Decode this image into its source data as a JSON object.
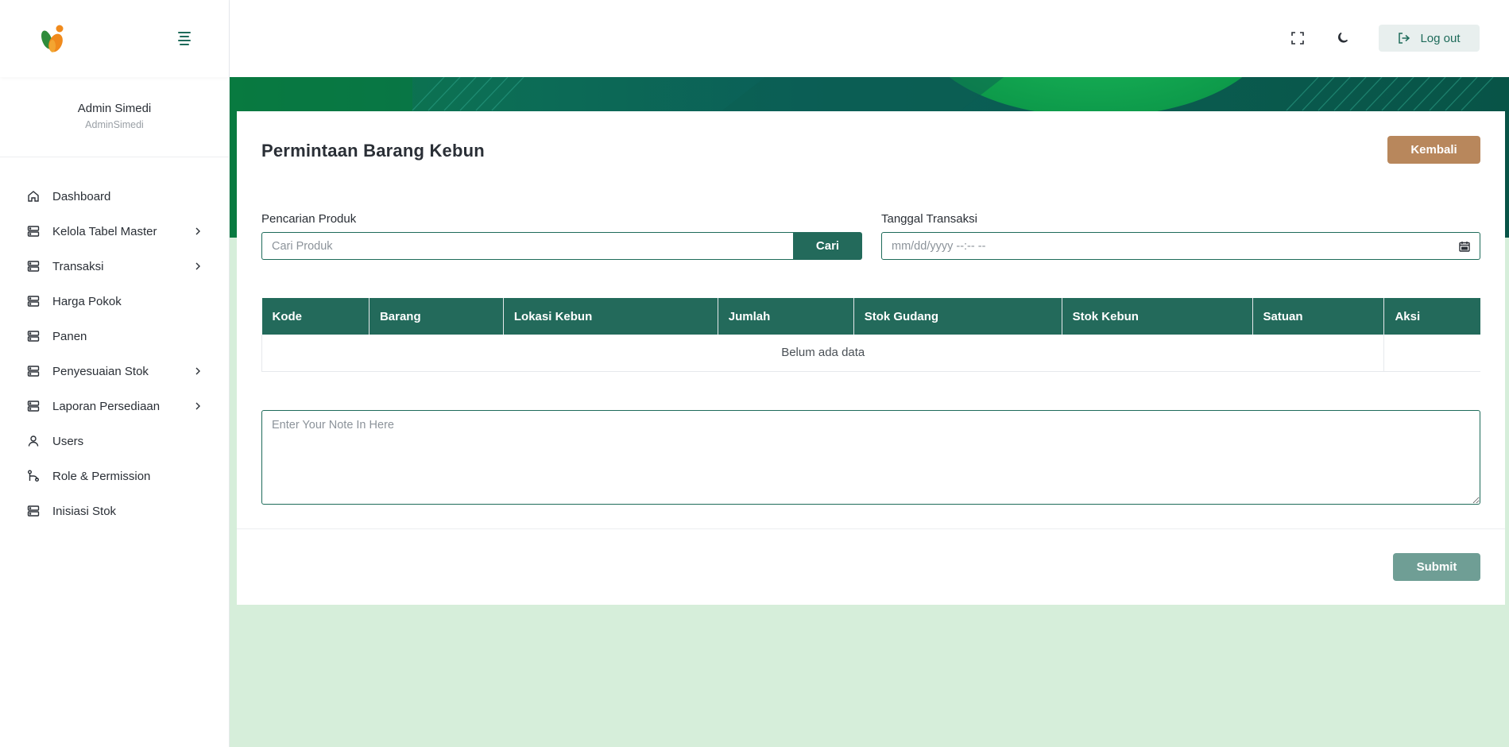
{
  "brand": {
    "logo_icon": "leaf-person-logo",
    "accent": "#236a5b",
    "accent_light": "#d6eeda"
  },
  "user": {
    "name": "Admin Simedi",
    "handle": "AdminSimedi"
  },
  "sidebar": {
    "items": [
      {
        "label": "Dashboard",
        "icon": "home-icon",
        "has_submenu": false
      },
      {
        "label": "Kelola Tabel Master",
        "icon": "server-icon",
        "has_submenu": true
      },
      {
        "label": "Transaksi",
        "icon": "server-icon",
        "has_submenu": true
      },
      {
        "label": "Harga Pokok",
        "icon": "server-icon",
        "has_submenu": false
      },
      {
        "label": "Panen",
        "icon": "server-icon",
        "has_submenu": false
      },
      {
        "label": "Penyesuaian Stok",
        "icon": "server-icon",
        "has_submenu": true
      },
      {
        "label": "Laporan Persediaan",
        "icon": "server-icon",
        "has_submenu": true
      },
      {
        "label": "Users",
        "icon": "user-icon",
        "has_submenu": false
      },
      {
        "label": "Role & Permission",
        "icon": "git-branch-icon",
        "has_submenu": false
      },
      {
        "label": "Inisiasi Stok",
        "icon": "server-icon",
        "has_submenu": false
      }
    ]
  },
  "header": {
    "logout_label": "Log out"
  },
  "page": {
    "title": "Permintaan Barang Kebun",
    "back_label": "Kembali",
    "search": {
      "label": "Pencarian Produk",
      "placeholder": "Cari Produk",
      "value": "",
      "button_label": "Cari"
    },
    "date": {
      "label": "Tanggal Transaksi",
      "placeholder": "mm/dd/yyyy --:-- --"
    },
    "table": {
      "columns": [
        "Kode",
        "Barang",
        "Lokasi Kebun",
        "Jumlah",
        "Stok Gudang",
        "Stok Kebun",
        "Satuan",
        "Aksi"
      ],
      "empty_text": "Belum ada data"
    },
    "note_placeholder": "Enter Your Note In Here",
    "submit_label": "Submit"
  }
}
